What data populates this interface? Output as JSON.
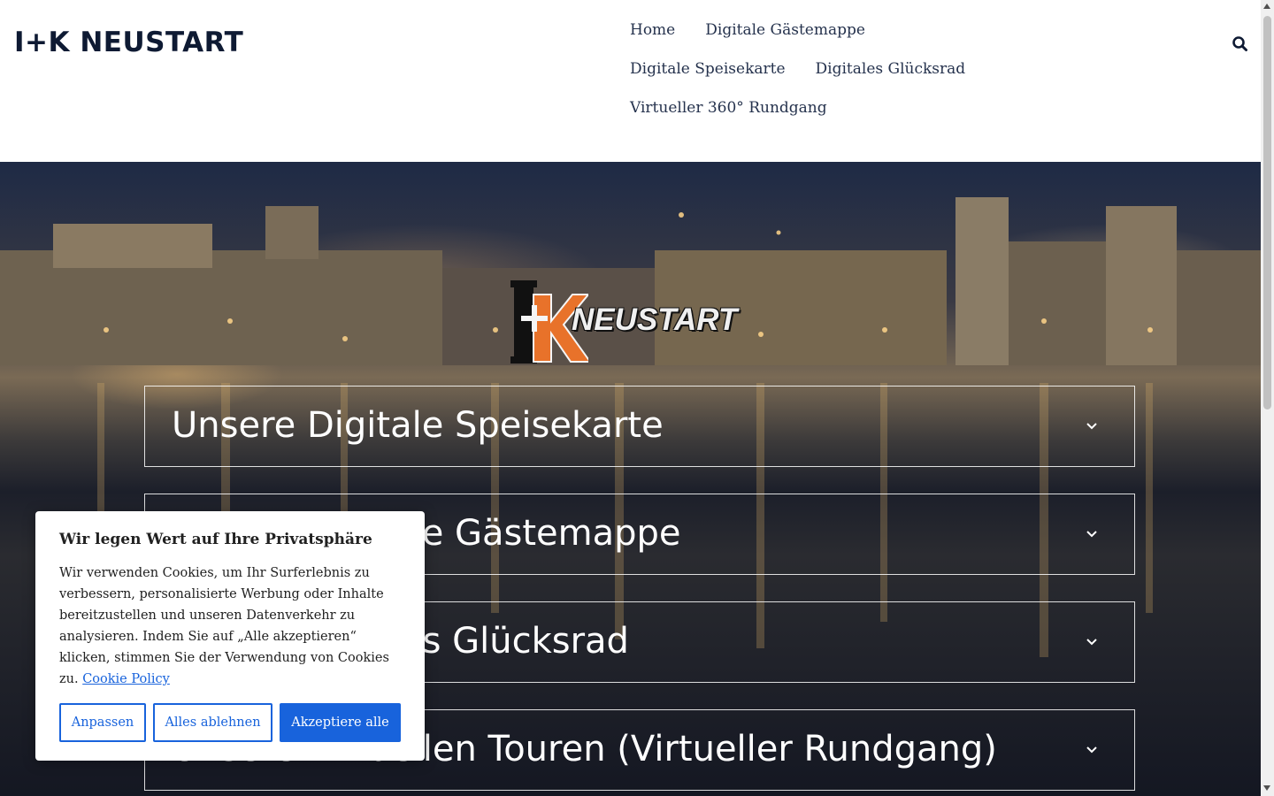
{
  "header": {
    "site_title": "I+K NEUSTART",
    "nav": [
      {
        "label": "Home"
      },
      {
        "label": "Digitale Gästemappe"
      },
      {
        "label": "Digitale Speisekarte"
      },
      {
        "label": "Digitales Glücksrad"
      },
      {
        "label": "Virtueller 360° Rundgang"
      }
    ],
    "search_icon": "search-icon"
  },
  "hero": {
    "logo_text": "I+K NEUSTART",
    "accordion": [
      {
        "title": "Unsere Digitale Speisekarte",
        "icon": "chevron-down-icon"
      },
      {
        "title": "Unsere Digitale Gästemappe",
        "icon": "chevron-down-icon"
      },
      {
        "title": "Unser Digitales Glücksrad",
        "icon": "chevron-down-icon"
      },
      {
        "title": "Unsere Virtuellen Touren (Virtueller Rundgang)",
        "icon": "chevron-down-icon"
      }
    ]
  },
  "cookie_banner": {
    "title": "Wir legen Wert auf Ihre Privatsphäre",
    "text": "Wir verwenden Cookies, um Ihr Surferlebnis zu verbessern, personalisierte Werbung oder Inhalte bereitzustellen und unseren Datenverkehr zu analysieren. Indem Sie auf „Alle akzeptieren“ klicken, stimmen Sie der Verwendung von Cookies zu.",
    "link": "Cookie Policy",
    "buttons": {
      "customize": "Anpassen",
      "reject": "Alles ablehnen",
      "accept": "Akzeptiere alle"
    }
  },
  "colors": {
    "brand_dark": "#0e1a33",
    "nav_text": "#25324d",
    "cookie_accent": "#1863dc",
    "logo_orange": "#e8722a"
  }
}
